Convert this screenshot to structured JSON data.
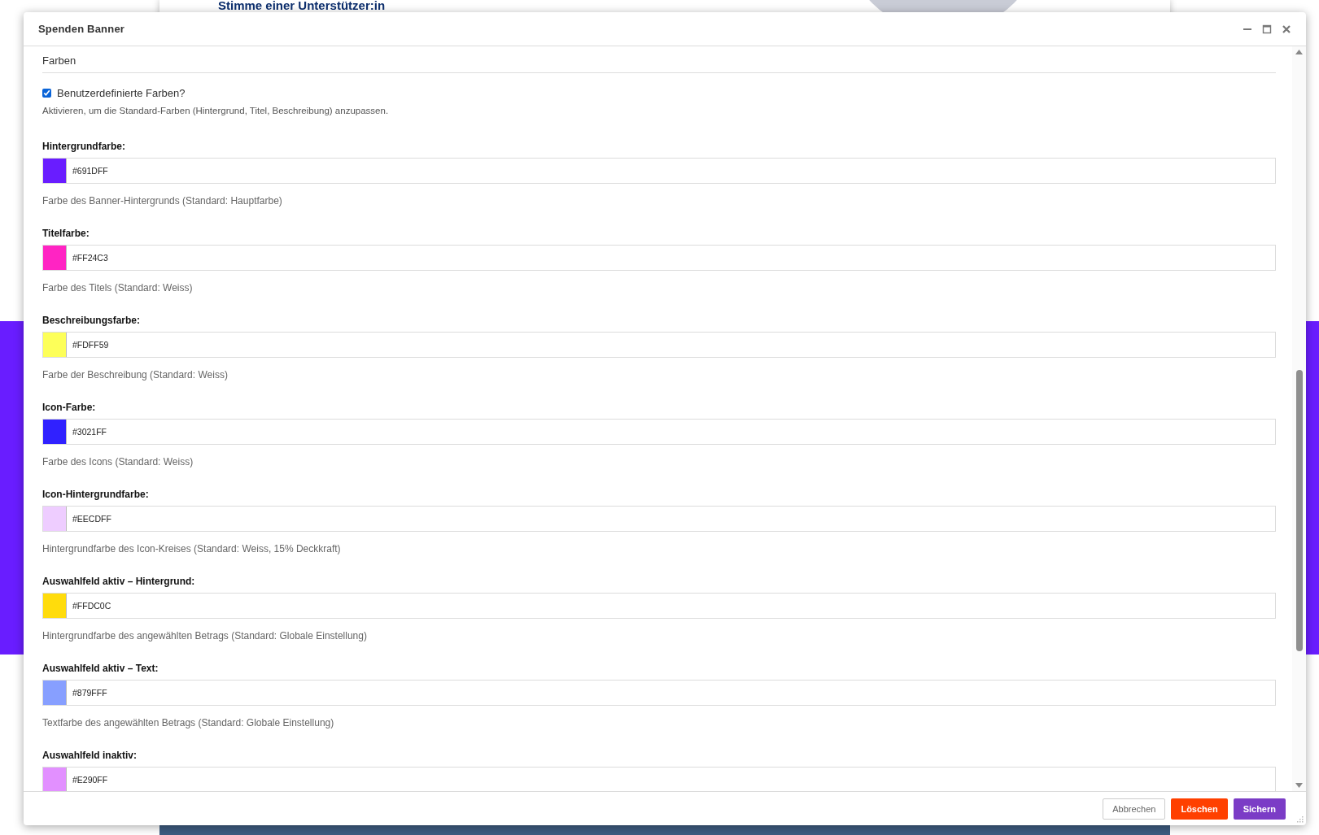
{
  "background_page": {
    "heading": "Stimme einer Unterstützer:in"
  },
  "dialog": {
    "title": "Spenden Banner",
    "section": "Farben",
    "custom_colors": {
      "label": "Benutzerdefinierte Farben?",
      "checked": true,
      "help": "Aktivieren, um die Standard-Farben (Hintergrund, Titel, Beschreibung) anzupassen."
    },
    "fields": [
      {
        "label": "Hintergrundfarbe:",
        "value": "#691DFF",
        "color": "#691dff",
        "help": "Farbe des Banner-Hintergrunds (Standard: Hauptfarbe)"
      },
      {
        "label": "Titelfarbe:",
        "value": "#FF24C3",
        "color": "#ff24c3",
        "help": "Farbe des Titels (Standard: Weiss)"
      },
      {
        "label": "Beschreibungsfarbe:",
        "value": "#FDFF59",
        "color": "#fdff59",
        "help": "Farbe der Beschreibung (Standard: Weiss)"
      },
      {
        "label": "Icon-Farbe:",
        "value": "#3021FF",
        "color": "#3021ff",
        "help": "Farbe des Icons (Standard: Weiss)"
      },
      {
        "label": "Icon-Hintergrundfarbe:",
        "value": "#EECDFF",
        "color": "#eecdff",
        "help": "Hintergrundfarbe des Icon-Kreises (Standard: Weiss, 15% Deckkraft)"
      },
      {
        "label": "Auswahlfeld aktiv – Hintergrund:",
        "value": "#FFDC0C",
        "color": "#ffdc0c",
        "help": "Hintergrundfarbe des angewählten Betrags (Standard: Globale Einstellung)"
      },
      {
        "label": "Auswahlfeld aktiv – Text:",
        "value": "#879FFF",
        "color": "#879fff",
        "help": "Textfarbe des angewählten Betrags (Standard: Globale Einstellung)"
      },
      {
        "label": "Auswahlfeld inaktiv:",
        "value": "#E290FF",
        "color": "#e290ff"
      }
    ],
    "buttons": [
      {
        "label": "Abbrechen",
        "kind": "secondary"
      },
      {
        "label": "Löschen",
        "kind": "danger"
      },
      {
        "label": "Sichern",
        "kind": "primary"
      }
    ]
  }
}
